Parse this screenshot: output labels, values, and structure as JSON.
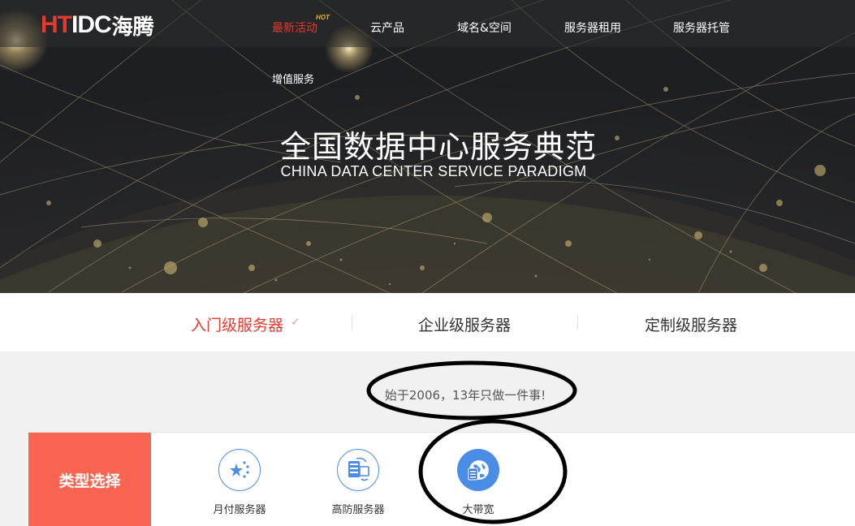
{
  "header": {
    "logo": {
      "ht": "HT",
      "idc": "IDC",
      "cn": "海腾"
    },
    "hot_badge": "HOT",
    "nav": [
      {
        "label": "最新活动"
      },
      {
        "label": "云产品"
      },
      {
        "label": "域名&空间"
      },
      {
        "label": "服务器租用"
      },
      {
        "label": "服务器托管"
      },
      {
        "label": "增值服务"
      }
    ]
  },
  "hero": {
    "title": "全国数据中心服务典范",
    "subtitle": "CHINA DATA CENTER SERVICE PARADIGM"
  },
  "tabs": [
    {
      "label": "入门级服务器"
    },
    {
      "label": "企业级服务器"
    },
    {
      "label": "定制级服务器"
    }
  ],
  "slogan": "始于2006，13年只做一件事!",
  "types": {
    "title": "类型选择",
    "items": [
      {
        "label": "月付服务器",
        "icon": "china-flag-icon"
      },
      {
        "label": "高防服务器",
        "icon": "server-shield-icon"
      },
      {
        "label": "大带宽",
        "icon": "globe-server-icon"
      }
    ]
  },
  "colors": {
    "accent_red": "#e8392f",
    "type_label_bg": "#fa6452",
    "icon_blue": "#4a8de6",
    "hot_badge": "#f0b21c"
  }
}
